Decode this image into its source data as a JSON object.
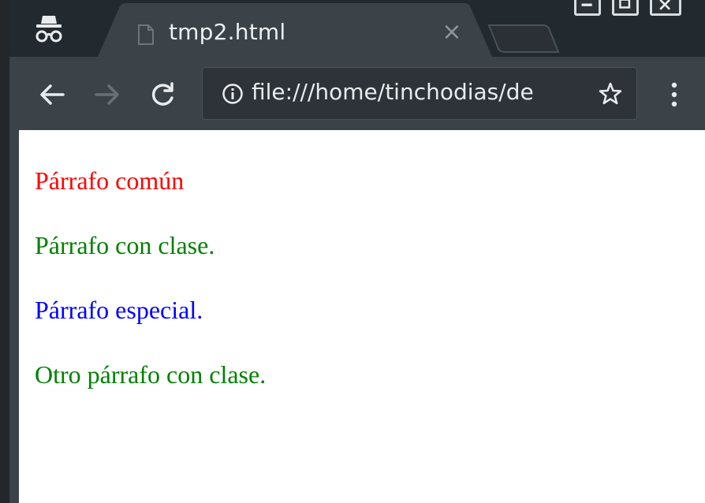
{
  "browser": {
    "tab": {
      "title": "tmp2.html",
      "close_glyph": "×",
      "icon": "file-icon"
    },
    "incognito_icon": "incognito-icon",
    "window_controls": [
      "minimize-icon",
      "maximize-icon",
      "close-icon"
    ],
    "toolbar": {
      "back_icon": "arrow-left-icon",
      "forward_icon": "arrow-right-icon",
      "reload_icon": "reload-icon",
      "menu_icon": "kebab-menu-icon"
    },
    "omnibox": {
      "info_icon": "info-icon",
      "url": "file:///home/tinchodias/de",
      "bookmark_icon": "star-icon"
    }
  },
  "page": {
    "paragraphs": [
      {
        "text": "Párrafo común",
        "color": "#ff0000"
      },
      {
        "text": "Párrafo con clase.",
        "color": "#008000"
      },
      {
        "text": "Párrafo especial.",
        "color": "#0000ff"
      },
      {
        "text": "Otro párrafo con clase.",
        "color": "#008000"
      }
    ]
  },
  "colors": {
    "tabstrip_bg": "#232a2f",
    "toolbar_bg": "#3b4248",
    "omnibox_bg": "#2d3338",
    "page_bg": "#ffffff"
  }
}
